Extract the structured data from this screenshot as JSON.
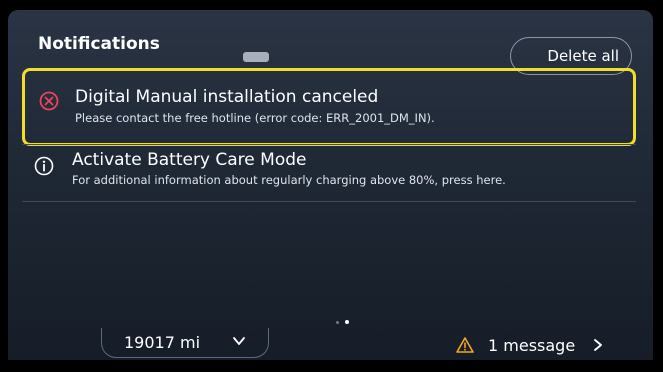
{
  "header": {
    "title": "Notifications",
    "delete_all_label": "Delete all"
  },
  "notifications": [
    {
      "icon": "error-circle-icon",
      "title": "Digital Manual installation canceled",
      "body": "Please contact the free hotline (error code: ERR_2001_DM_IN).",
      "highlighted": true,
      "icon_color": "#e8475a"
    },
    {
      "icon": "info-circle-icon",
      "title": "Activate Battery Care Mode",
      "body": "For additional information about regularly charging above 80%, press here.",
      "highlighted": false,
      "icon_color": "#ffffff"
    }
  ],
  "pager": {
    "pages": 2,
    "active": 2
  },
  "status_bar": {
    "odometer": "19017 mi",
    "messages": "1 message",
    "warning_color": "#f5a623"
  },
  "colors": {
    "highlight": "#f2dc2c",
    "screen_bg": "#1f2835"
  }
}
